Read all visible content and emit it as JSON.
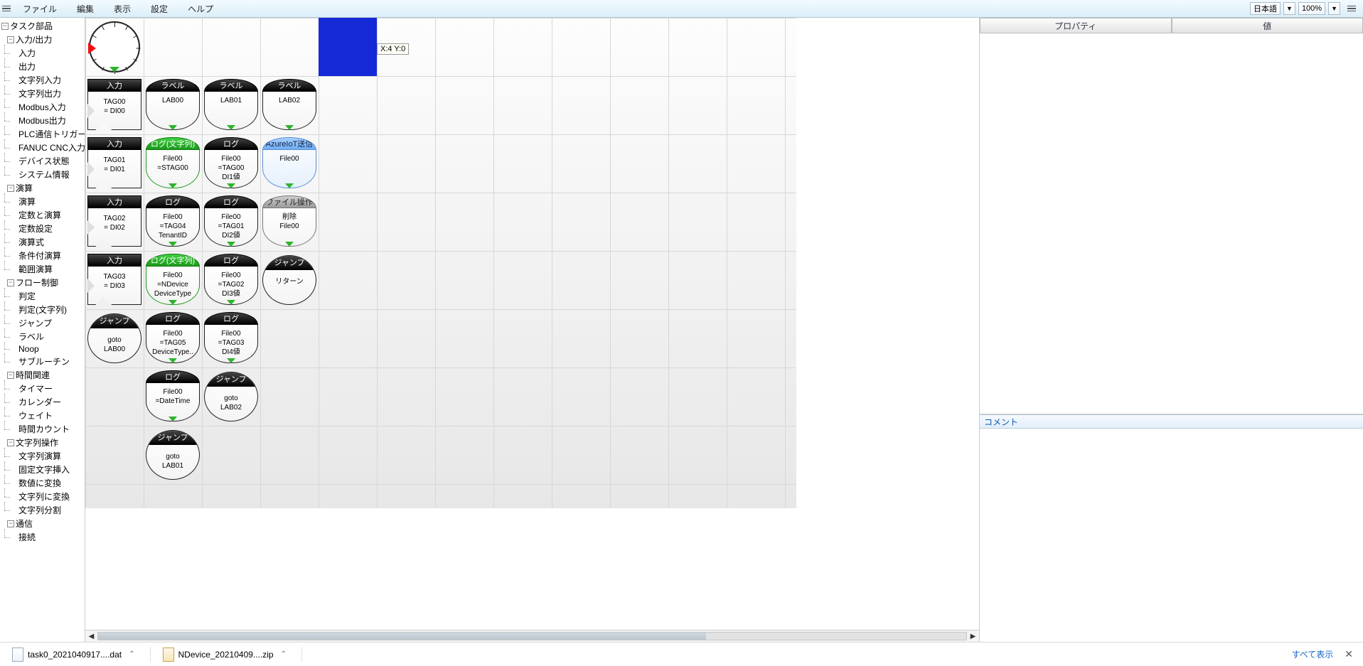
{
  "menu": {
    "items": [
      "ファイル",
      "編集",
      "表示",
      "設定",
      "ヘルプ"
    ],
    "lang": "日本語",
    "zoom": "100%"
  },
  "sidebar": {
    "root": "タスク部品",
    "categories": [
      {
        "label": "入力/出力",
        "items": [
          "入力",
          "出力",
          "文字列入力",
          "文字列出力",
          "Modbus入力",
          "Modbus出力",
          "PLC通信トリガー",
          "FANUC CNC入力",
          "デバイス状態",
          "システム情報"
        ]
      },
      {
        "label": "演算",
        "items": [
          "演算",
          "定数と演算",
          "定数設定",
          "演算式",
          "条件付演算",
          "範囲演算"
        ]
      },
      {
        "label": "フロー制御",
        "items": [
          "判定",
          "判定(文字列)",
          "ジャンプ",
          "ラベル",
          "Noop",
          "サブルーチン"
        ]
      },
      {
        "label": "時間関連",
        "items": [
          "タイマー",
          "カレンダー",
          "ウェイト",
          "時間カウント"
        ]
      },
      {
        "label": "文字列操作",
        "items": [
          "文字列演算",
          "固定文字挿入",
          "数値に変換",
          "文字列に変換",
          "文字列分割"
        ]
      },
      {
        "label": "通信",
        "items": [
          "接続"
        ]
      }
    ]
  },
  "canvas": {
    "tooltip": "X:4 Y:0",
    "selected": {
      "col": 4,
      "row": 0
    },
    "blocks": [
      {
        "type": "start",
        "col": 0,
        "row": 0
      },
      {
        "type": "in",
        "col": 0,
        "row": 1,
        "title": "入力",
        "lines": [
          "TAG00",
          "= DI00"
        ]
      },
      {
        "type": "blk",
        "style": "black",
        "col": 1,
        "row": 1,
        "title": "ラベル",
        "lines": [
          "LAB00"
        ]
      },
      {
        "type": "blk",
        "style": "black",
        "col": 2,
        "row": 1,
        "title": "ラベル",
        "lines": [
          "LAB01"
        ]
      },
      {
        "type": "blk",
        "style": "black",
        "col": 3,
        "row": 1,
        "title": "ラベル",
        "lines": [
          "LAB02"
        ]
      },
      {
        "type": "in",
        "col": 0,
        "row": 2,
        "title": "入力",
        "lines": [
          "TAG01",
          "= DI01"
        ]
      },
      {
        "type": "blk",
        "style": "green",
        "col": 1,
        "row": 2,
        "title": "ログ(文字列)",
        "lines": [
          "File00",
          "=STAG00"
        ]
      },
      {
        "type": "blk",
        "style": "black",
        "col": 2,
        "row": 2,
        "title": "ログ",
        "lines": [
          "File00",
          "=TAG00",
          "DI1値"
        ]
      },
      {
        "type": "blk",
        "style": "blue",
        "col": 3,
        "row": 2,
        "title": "AzureIoT送信",
        "lines": [
          "File00"
        ]
      },
      {
        "type": "in",
        "col": 0,
        "row": 3,
        "title": "入力",
        "lines": [
          "TAG02",
          "= DI02"
        ]
      },
      {
        "type": "blk",
        "style": "black",
        "col": 1,
        "row": 3,
        "title": "ログ",
        "lines": [
          "File00",
          "=TAG04",
          "TenantID"
        ]
      },
      {
        "type": "blk",
        "style": "black",
        "col": 2,
        "row": 3,
        "title": "ログ",
        "lines": [
          "File00",
          "=TAG01",
          "DI2値"
        ]
      },
      {
        "type": "blk",
        "style": "grey",
        "col": 3,
        "row": 3,
        "title": "ファイル操作",
        "lines": [
          "削除",
          "File00"
        ]
      },
      {
        "type": "in",
        "col": 0,
        "row": 4,
        "title": "入力",
        "lines": [
          "TAG03",
          "= DI03"
        ]
      },
      {
        "type": "blk",
        "style": "green",
        "col": 1,
        "row": 4,
        "title": "ログ(文字列)",
        "lines": [
          "File00",
          "=NDevice",
          "DeviceType"
        ]
      },
      {
        "type": "blk",
        "style": "black",
        "col": 2,
        "row": 4,
        "title": "ログ",
        "lines": [
          "File00",
          "=TAG02",
          "DI3値"
        ]
      },
      {
        "type": "ell",
        "col": 3,
        "row": 4,
        "title": "ジャンプ",
        "lines": [
          "リターン"
        ]
      },
      {
        "type": "ell",
        "col": 0,
        "row": 5,
        "title": "ジャンプ",
        "lines": [
          "goto",
          "LAB00"
        ]
      },
      {
        "type": "blk",
        "style": "black",
        "col": 1,
        "row": 5,
        "title": "ログ",
        "lines": [
          "File00",
          "=TAG05",
          "DeviceType.."
        ]
      },
      {
        "type": "blk",
        "style": "black",
        "col": 2,
        "row": 5,
        "title": "ログ",
        "lines": [
          "File00",
          "=TAG03",
          "DI4値"
        ]
      },
      {
        "type": "blk",
        "style": "black",
        "col": 1,
        "row": 6,
        "title": "ログ",
        "lines": [
          "File00",
          "=DateTime"
        ]
      },
      {
        "type": "ell",
        "col": 2,
        "row": 6,
        "title": "ジャンプ",
        "lines": [
          "goto",
          "LAB02"
        ]
      },
      {
        "type": "ell",
        "col": 1,
        "row": 7,
        "title": "ジャンプ",
        "lines": [
          "goto",
          "LAB01"
        ]
      }
    ]
  },
  "props": {
    "col_property": "プロパティ",
    "col_value": "値"
  },
  "comment": {
    "label": "コメント",
    "value": ""
  },
  "downloads": {
    "files": [
      {
        "name": "task0_2021040917....dat",
        "icon": "dat"
      },
      {
        "name": "NDevice_20210409....zip",
        "icon": "zip"
      }
    ],
    "showall": "すべて表示"
  }
}
